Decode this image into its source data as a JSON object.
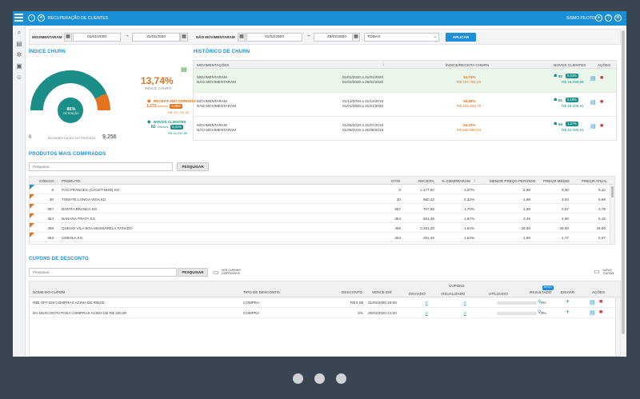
{
  "topbar": {
    "title": "RECUPERAÇÃO DE CLIENTES",
    "user": "SISMO PILOTO"
  },
  "filters": {
    "label_mov": "MOVIMENTARAM",
    "date_from": "01/01/2020",
    "date_to": "31/01/2020",
    "label_nao_mov": "NÃO MOVIMENTARAM",
    "date_from2": "01/02/2020",
    "date_to2": "29/02/2020",
    "select": "TODAS",
    "apply": "APLICAR"
  },
  "churn": {
    "title": "ÍNDICE CHURN",
    "value": "13,74%",
    "label": "ÍNDICE CHURN",
    "gauge_pct": "86%",
    "gauge_label": "RETENÇÃO",
    "gauge_fraction": 0.86,
    "zero": "0",
    "max": "9.256",
    "caption": "MOVIMENTAÇÃO NO PERÍODO",
    "receita_label": "RECEITA RECORRENTE",
    "receita_clients": "1.272",
    "receita_clients_word": "clientes",
    "receita_pct": "3,88%",
    "receita_value": "R$ 107.751,20",
    "novos_label": "NOVOS CLIENTES",
    "novos_clients": "82",
    "novos_clients_word": "clientes",
    "novos_pct": "0,41%",
    "novos_value": "R$ 16.290,89"
  },
  "historico": {
    "title": "HISTÓRICO DE CHURN",
    "headers": [
      "MOVIMENTAÇÕES",
      "ÍNDICE/RECEITA CHURN",
      "NOVOS CLIENTES",
      "AÇÕES"
    ],
    "rows": [
      {
        "l1": "MOVIMENTARAM",
        "l2": "NÃO MOVIMENTARAM",
        "d1": "01/01/2020 a 31/01/2020",
        "d2": "01/02/2020 a 29/02/2020",
        "pct": "13,74%",
        "val": "R$ 107.751,20",
        "nc": "82",
        "ncp": "0,41%",
        "ncv": "R$ 16.290,89"
      },
      {
        "l1": "MOVIMENTARAM",
        "l2": "NÃO MOVIMENTARAM",
        "d1": "01/12/2019 a 31/12/2019",
        "d2": "01/01/2020 a 31/01/2020",
        "pct": "19,88%",
        "val": "R$ 451.328,79",
        "nc": "91",
        "ncp": "0,19%",
        "ncv": "R$ 19.209,91"
      },
      {
        "l1": "MOVIMENTARAM",
        "l2": "NÃO MOVIMENTARAM",
        "d1": "01/06/2019 a 31/07/2019",
        "d2": "01/08/2019 a 31/08/2019",
        "pct": "26,33%",
        "val": "R$ 560.960,04",
        "nc": "94",
        "ncp": "1,27%",
        "ncv": "R$ 10.290,51"
      }
    ]
  },
  "produtos": {
    "title": "PRODUTOS MAIS COMPRADOS",
    "placeholder": "Pesquisar...",
    "search_btn": "PESQUISAR",
    "headers": [
      "CÓDIGO",
      "PRODUTO",
      "GTIN",
      "RECEITA",
      "% COMPRARAM",
      "MENOR PREÇO PERÍODO",
      "PREÇO MÉDIO",
      "PREÇO ATUAL"
    ],
    "rows": [
      {
        "code": "8",
        "name": "PÃO FRANCES (CACETINHO) KG",
        "gtin": "0",
        "rec": "1.477,60",
        "pct": "3,07%",
        "min": "5,98",
        "avg": "8,30",
        "cur": "9,10"
      },
      {
        "code": "30",
        "name": "TOMATE LONGA VIDA KG",
        "gtin": "30",
        "rec": "880,22",
        "pct": "2,32%",
        "min": "1,99",
        "avg": "3,93",
        "cur": "5,69"
      },
      {
        "code": "957",
        "name": "BATATA BRANCA KG",
        "gtin": "957",
        "rec": "707,85",
        "pct": "1,70%",
        "min": "1,99",
        "avg": "2,57",
        "cur": "3,79"
      },
      {
        "code": "354",
        "name": "BANANA PRATA KG",
        "gtin": "354",
        "rec": "661,46",
        "pct": "1,67%",
        "min": "3,49",
        "avg": "4,96",
        "cur": "5,15"
      },
      {
        "code": "496",
        "name": "QUEIJO VILA BOA MUSSARELA FATIADO",
        "gtin": "496",
        "rec": "2.261,25",
        "pct": "1,64%",
        "min": "28,90",
        "avg": "28,90",
        "cur": "29,90"
      },
      {
        "code": "363",
        "name": "CEBOLA KG",
        "gtin": "363",
        "rec": "251,49",
        "pct": "1,53%",
        "min": "1,59",
        "avg": "1,77",
        "cur": "0,07"
      }
    ]
  },
  "cupons": {
    "title": "CUPONS DE DESCONTO",
    "placeholder": "Pesquisar...",
    "search_btn": "PESQUISAR",
    "link1": "VER CUPONS DISPONÍVEIS",
    "novo": "NOVO CUPOM",
    "group": "CUPONS",
    "badge": "NOVO",
    "headers": [
      "NOME DO CUPOM",
      "TIPO DE DESCONTO",
      "DESCONTO",
      "VENCE EM",
      "ENVIADO",
      "VISUALIZADO",
      "UTILIZADO",
      "RESULTADO",
      "ENVIAR",
      "AÇÕES"
    ],
    "rows": [
      {
        "name": "R$5 OFF EM COMPRAS ACIMA DE R$100",
        "type": "COMPRA",
        "disc": "R$ 5,00",
        "exp": "31/03/2020 18:59",
        "env": "0",
        "vis": "0",
        "uti": "0%"
      },
      {
        "name": "5% DESCONTO PARA COMPRAS ACIMA DE R$ 100,00",
        "type": "COMPRA",
        "disc": "5%",
        "exp": "25/03/2020 21:00",
        "env": "0",
        "vis": "0",
        "uti": "0%"
      }
    ]
  },
  "colors": {
    "accent": "#1a8fd6",
    "teal": "#1c8e88",
    "orange": "#e4731f"
  }
}
